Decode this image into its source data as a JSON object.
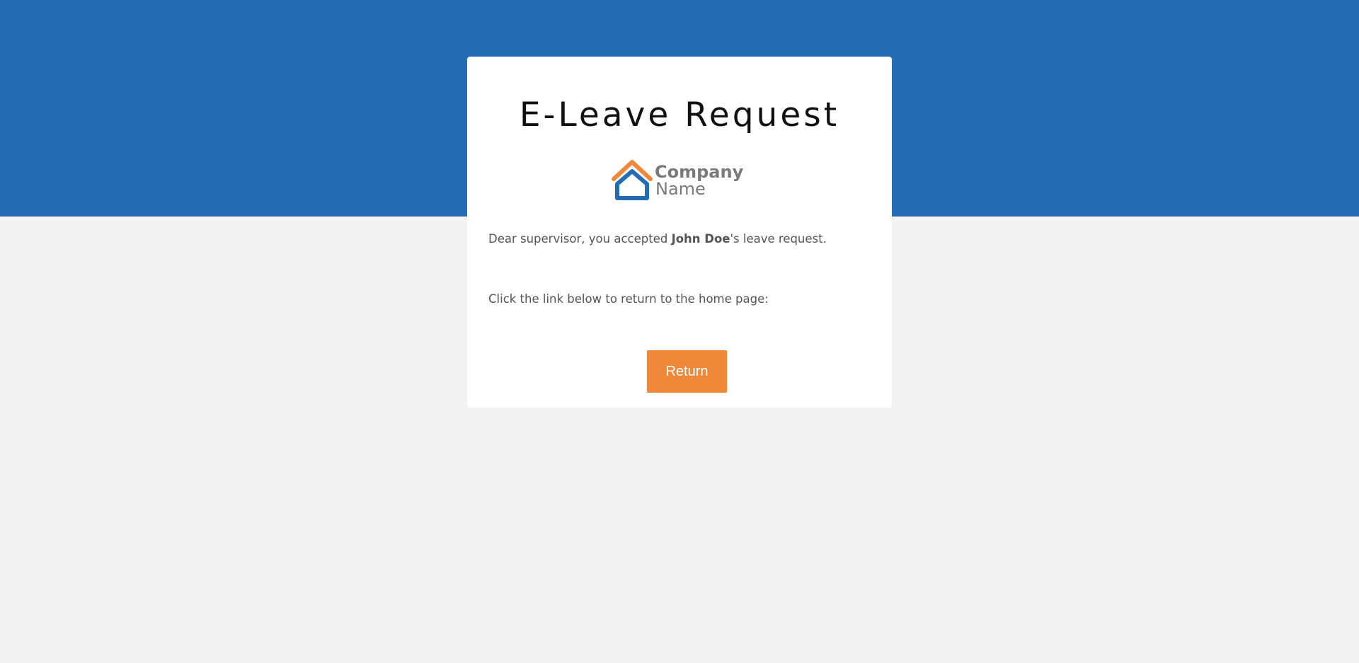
{
  "page": {
    "title": "E-Leave Request"
  },
  "logo": {
    "line1": "Company",
    "line2": "Name"
  },
  "message": {
    "part1": "Dear supervisor, you accepted ",
    "employee_name": "John Doe",
    "part2": "'s leave request.",
    "instruction": "Click the link below to return to the home page:"
  },
  "actions": {
    "return_label": "Return"
  },
  "colors": {
    "header_blue": "#246db5",
    "background": "#f3f3f3",
    "button_orange": "#f0883a",
    "logo_orange": "#f0883a",
    "logo_blue": "#246db5"
  }
}
